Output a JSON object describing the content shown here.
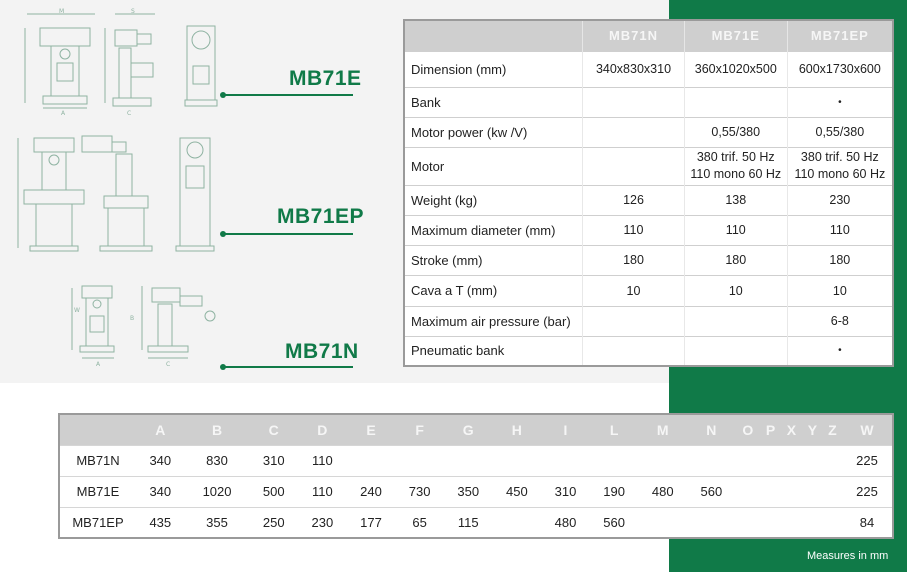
{
  "models": {
    "mb71e": "MB71E",
    "mb71ep": "MB71EP",
    "mb71n": "MB71N"
  },
  "spec_table": {
    "columns": [
      "MB71N",
      "MB71E",
      "MB71EP"
    ],
    "rows": [
      {
        "label": "Dimension (mm)",
        "values": [
          "340x830x310",
          "360x1020x500",
          "600x1730x600"
        ]
      },
      {
        "label": "Bank",
        "values": [
          "",
          "",
          "•"
        ]
      },
      {
        "label": "Motor power (kw /V)",
        "values": [
          "",
          "0,55/380",
          "0,55/380"
        ]
      },
      {
        "label": "Motor",
        "values": [
          "",
          "380 trif. 50 Hz\n110 mono 60 Hz",
          "380 trif. 50 Hz\n110 mono 60 Hz"
        ]
      },
      {
        "label": "Weight (kg)",
        "values": [
          "126",
          "138",
          "230"
        ]
      },
      {
        "label": "Maximum diameter (mm)",
        "values": [
          "110",
          "110",
          "110"
        ]
      },
      {
        "label": "Stroke (mm)",
        "values": [
          "180",
          "180",
          "180"
        ]
      },
      {
        "label": "Cava a T (mm)",
        "values": [
          "10",
          "10",
          "10"
        ]
      },
      {
        "label": "Maximum air pressure (bar)",
        "values": [
          "",
          "",
          "6-8"
        ]
      },
      {
        "label": "Pneumatic bank",
        "values": [
          "",
          "",
          "•"
        ]
      }
    ]
  },
  "dimension_table": {
    "headers": [
      "A",
      "B",
      "C",
      "D",
      "E",
      "F",
      "G",
      "H",
      "I",
      "L",
      "M",
      "N",
      "O",
      "P",
      "X",
      "Y",
      "Z",
      "W"
    ],
    "rows": [
      {
        "model": "MB71N",
        "values": [
          "340",
          "830",
          "310",
          "110",
          "",
          "",
          "",
          "",
          "",
          "",
          "",
          "",
          "",
          "",
          "",
          "",
          "",
          "225"
        ]
      },
      {
        "model": "MB71E",
        "values": [
          "340",
          "1020",
          "500",
          "110",
          "240",
          "730",
          "350",
          "450",
          "310",
          "190",
          "480",
          "560",
          "",
          "",
          "",
          "",
          "",
          "225"
        ]
      },
      {
        "model": "MB71EP",
        "values": [
          "435",
          "355",
          "250",
          "230",
          "177",
          "65",
          "115",
          "",
          "480",
          "560",
          "",
          "",
          "",
          "",
          "",
          "",
          "",
          "84"
        ]
      }
    ]
  },
  "footnote": "Measures in mm",
  "colors": {
    "brand_green": "#107a48",
    "header_gray": "#cfcfcf",
    "drawing_ink": "#8fb3a2"
  }
}
